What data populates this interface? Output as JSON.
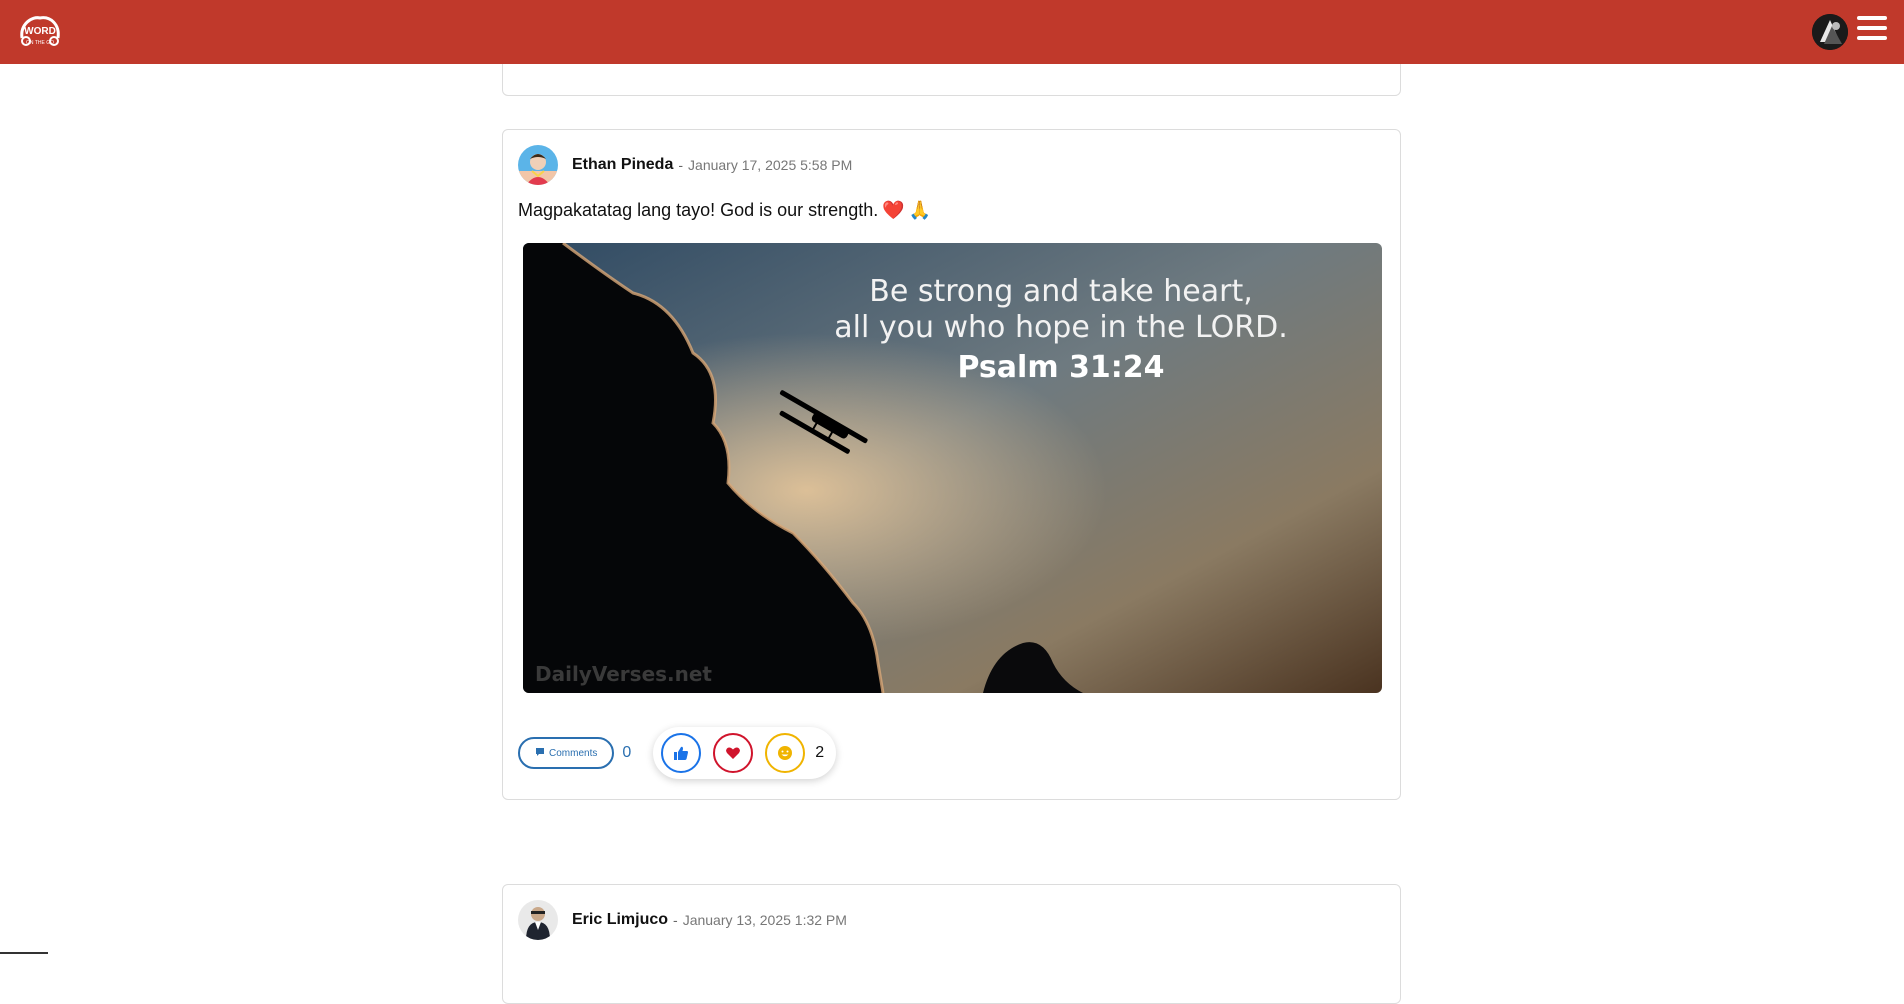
{
  "header": {
    "logo_icon": "word-on-the-go-logo",
    "avatar_icon": "user-avatar",
    "menu_icon": "hamburger-menu-icon",
    "bar_color": "#c0392b"
  },
  "posts": [
    {
      "author": "Ethan Pineda",
      "separator": "-",
      "timestamp": "January 17, 2025 5:58 PM",
      "text": "Magpakatatag lang tayo! God is our strength.",
      "text_emojis": [
        "❤️",
        "🙏"
      ],
      "image": {
        "verse_line1": "Be strong and take heart,",
        "verse_line2": "all you who hope in the LORD.",
        "verse_ref": "Psalm 31:24",
        "watermark": "DailyVerses.net"
      },
      "comments_label": "Comments",
      "comments_count": "0",
      "reactions": [
        "like",
        "heart",
        "smile"
      ],
      "reactions_count": "2"
    },
    {
      "author": "Eric Limjuco",
      "separator": "-",
      "timestamp": "January 13, 2025 1:32 PM"
    }
  ],
  "colors": {
    "like": "#1a73e8",
    "heart": "#d0142c",
    "smile": "#f0b400",
    "comment_accent": "#2a6fb0"
  }
}
